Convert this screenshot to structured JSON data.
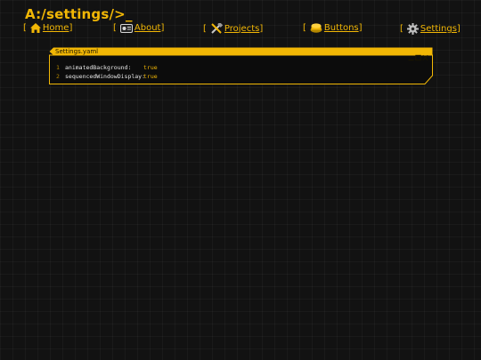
{
  "header": {
    "path": "A:/settings/>_"
  },
  "nav": {
    "home": "Home",
    "about": "About",
    "projects": "Projects",
    "buttons": "Buttons",
    "settings": "Settings",
    "open_bracket": "[",
    "close_bracket": "]"
  },
  "window": {
    "title": "Settings.yaml",
    "lines": [
      {
        "num": "1",
        "key": "animatedBackground:",
        "value": "true"
      },
      {
        "num": "2",
        "key": "sequencedWindowDisplay:",
        "value": "true"
      }
    ]
  },
  "colors": {
    "accent": "#f2b705",
    "background": "#121212",
    "text": "#e8e8e8"
  },
  "icons": [
    "home-icon",
    "about-icon",
    "tools-icon",
    "button-icon",
    "gear-icon",
    "minimize-icon",
    "maximize-icon",
    "close-icon"
  ]
}
